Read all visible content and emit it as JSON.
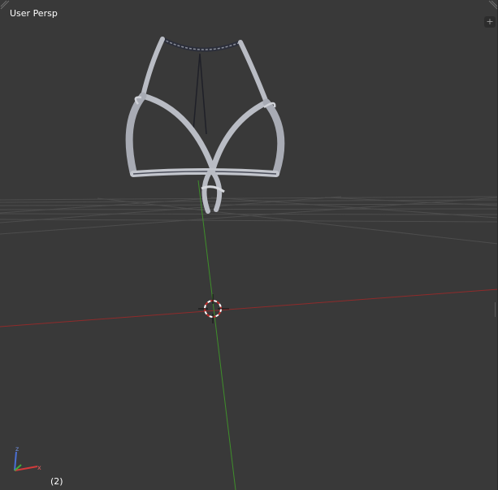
{
  "viewport": {
    "view_label": "User Persp",
    "frame_label": "(2)",
    "icons": {
      "top_left": "corner-drag-icon",
      "top_right": "corner-drag-icon",
      "split": "plus-icon",
      "cursor": "3d-cursor-icon",
      "axis_gizmo": "axis-gizmo-icon"
    },
    "axis_gizmo_labels": {
      "z": "z",
      "x": "x"
    },
    "colors": {
      "background": "#393939",
      "grid": "#4a4a4a",
      "x_axis": "#8f2b2b",
      "y_axis": "#3f8f2b",
      "mesh": "#b9bcc4",
      "mesh_shadow": "#5a5d68"
    }
  }
}
